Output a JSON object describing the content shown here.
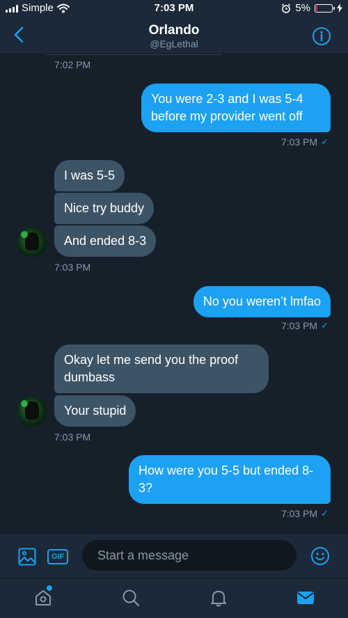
{
  "status_bar": {
    "carrier": "Simple",
    "time": "7:03 PM",
    "battery": "5%",
    "battery_level": 0.05
  },
  "header": {
    "name": "Orlando",
    "handle": "@EgLethal"
  },
  "messages": {
    "ts1": "7:02 PM",
    "sent1": "You were 2-3 and I was 5-4 before my provider went off",
    "ts2": "7:03 PM",
    "recv1": "I was 5-5",
    "recv2": "Nice try buddy",
    "recv3": "And ended 8-3",
    "ts3": "7:03 PM",
    "sent2": "No you weren’t lmfao",
    "ts4": "7:03 PM",
    "recv4": "Okay let me send you the proof dumbass",
    "recv5": "Your stupid",
    "ts5": "7:03 PM",
    "sent3": "How were you 5-5 but ended 8-3?",
    "ts6": "7:03 PM",
    "read_mark": "✓"
  },
  "composer": {
    "gif_label": "GIF",
    "placeholder": "Start a message"
  },
  "icons": {
    "back": "chevron-left-icon",
    "info": "info-icon",
    "media": "image-icon",
    "emoji": "smiley-icon",
    "home": "home-icon",
    "search": "search-icon",
    "notifications": "bell-icon",
    "messages": "mail-icon"
  },
  "colors": {
    "accent": "#1da1f2",
    "background": "#15202b",
    "received_bubble": "#3d5466",
    "muted_text": "#8899a6"
  }
}
